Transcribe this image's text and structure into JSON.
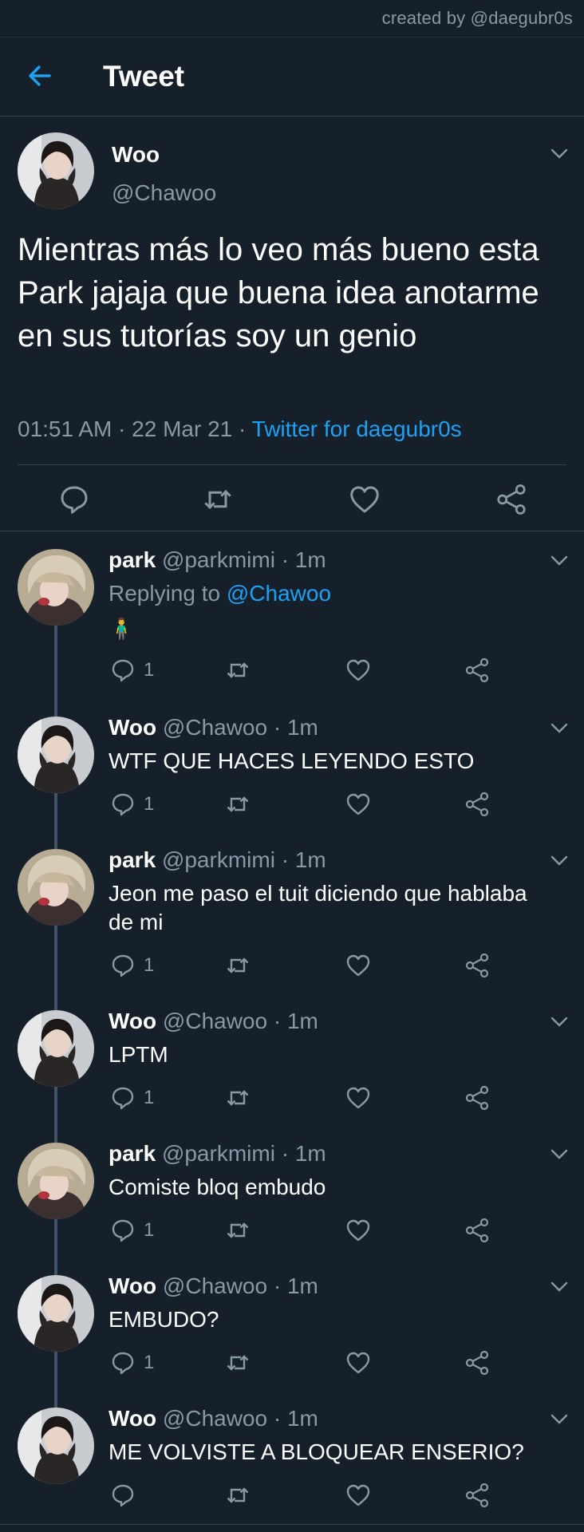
{
  "watermark": "created by @daegubr0s",
  "header": {
    "title": "Tweet"
  },
  "main_tweet": {
    "name": "Woo",
    "handle": "@Chawoo",
    "text": "Mientras más lo veo más bueno esta Park jajaja que buena idea anotarme en sus tutorías soy un genio",
    "time": "01:51 AM · 22 Mar 21 · ",
    "source": "Twitter for daegubr0s"
  },
  "replies": [
    {
      "name": "park",
      "handle": "@parkmimi · 1m",
      "replying_prefix": "Replying to ",
      "replying_to": "@Chawoo",
      "text": "🧍‍♂️",
      "reply_count": "1"
    },
    {
      "name": "Woo",
      "handle": "@Chawoo · 1m",
      "text": "WTF QUE HACES LEYENDO ESTO",
      "reply_count": "1"
    },
    {
      "name": "park",
      "handle": "@parkmimi · 1m",
      "text": "Jeon me paso el tuit diciendo que hablaba de mi",
      "reply_count": "1"
    },
    {
      "name": "Woo",
      "handle": "@Chawoo · 1m",
      "text": "LPTM",
      "reply_count": "1"
    },
    {
      "name": "park",
      "handle": "@parkmimi · 1m",
      "text": "Comiste bloq embudo",
      "reply_count": "1"
    },
    {
      "name": "Woo",
      "handle": "@Chawoo · 1m",
      "text": "EMBUDO?",
      "reply_count": "1"
    },
    {
      "name": "Woo",
      "handle": "@Chawoo · 1m",
      "text": "ME VOLVISTE A BLOQUEAR ENSERIO?",
      "reply_count": ""
    }
  ],
  "icons": {
    "back": "arrow-left-icon",
    "reply": "comment-icon",
    "retweet": "retweet-icon",
    "like": "heart-icon",
    "share": "share-icon",
    "more": "chevron-down-icon"
  },
  "colors": {
    "background": "#15202b",
    "accent": "#1da1f2",
    "muted": "#8899a6",
    "divider": "#38444d"
  }
}
